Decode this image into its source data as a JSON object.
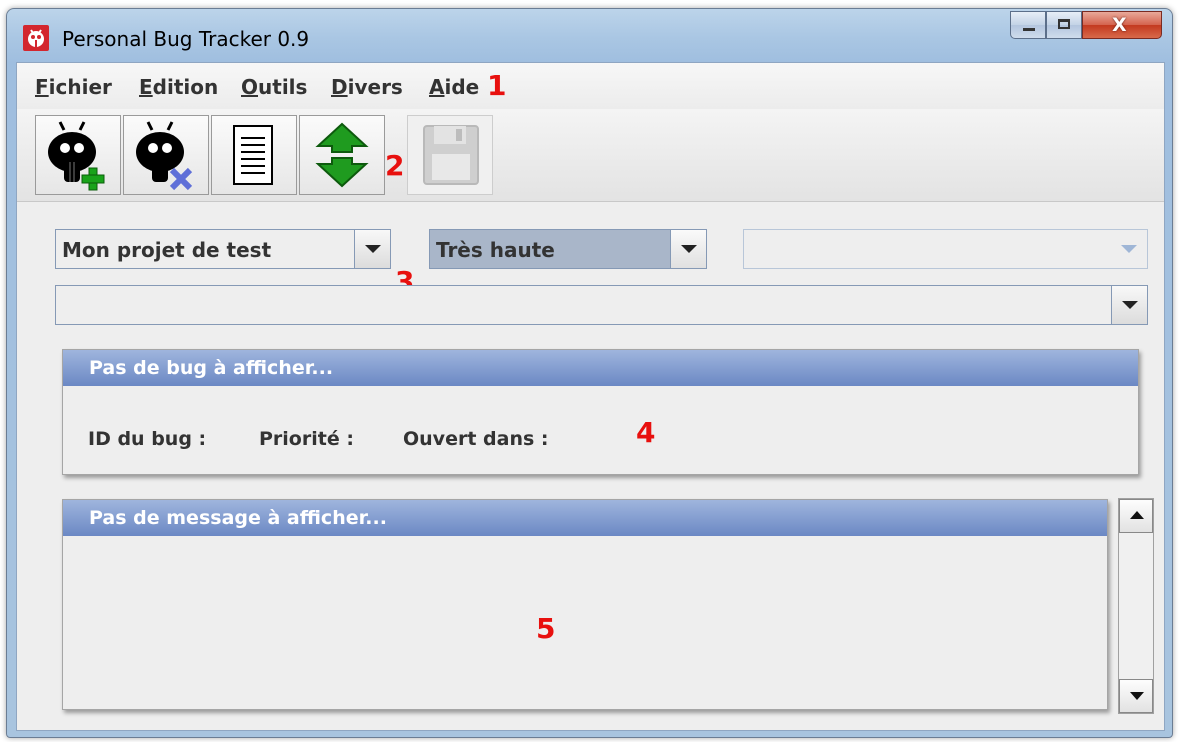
{
  "window": {
    "title": "Personal Bug Tracker 0.9",
    "icon": "bug-app-icon",
    "close_glyph": "X"
  },
  "menu": {
    "items": [
      "Fichier",
      "Edition",
      "Outils",
      "Divers",
      "Aide"
    ]
  },
  "toolbar": {
    "buttons": [
      {
        "icon": "add-bug-icon",
        "enabled": true
      },
      {
        "icon": "delete-bug-icon",
        "enabled": true
      },
      {
        "icon": "document-icon",
        "enabled": true
      },
      {
        "icon": "sync-arrows-icon",
        "enabled": true
      },
      {
        "icon": "save-icon",
        "enabled": false
      }
    ]
  },
  "filters": {
    "project": "Mon projet de test",
    "priority": "Très haute",
    "third": "",
    "bug_selector": ""
  },
  "bug_panel": {
    "title": "Pas de bug à afficher...",
    "id_label": "ID du bug :",
    "priority_label": "Priorité :",
    "opened_label": "Ouvert dans :"
  },
  "message_panel": {
    "title": "Pas de message à afficher..."
  },
  "annotations": [
    "1",
    "2",
    "3",
    "4",
    "5"
  ],
  "colors": {
    "annotation": "#e8100e",
    "panel_header": "#6b88c4",
    "app_icon": "#d3262e"
  }
}
